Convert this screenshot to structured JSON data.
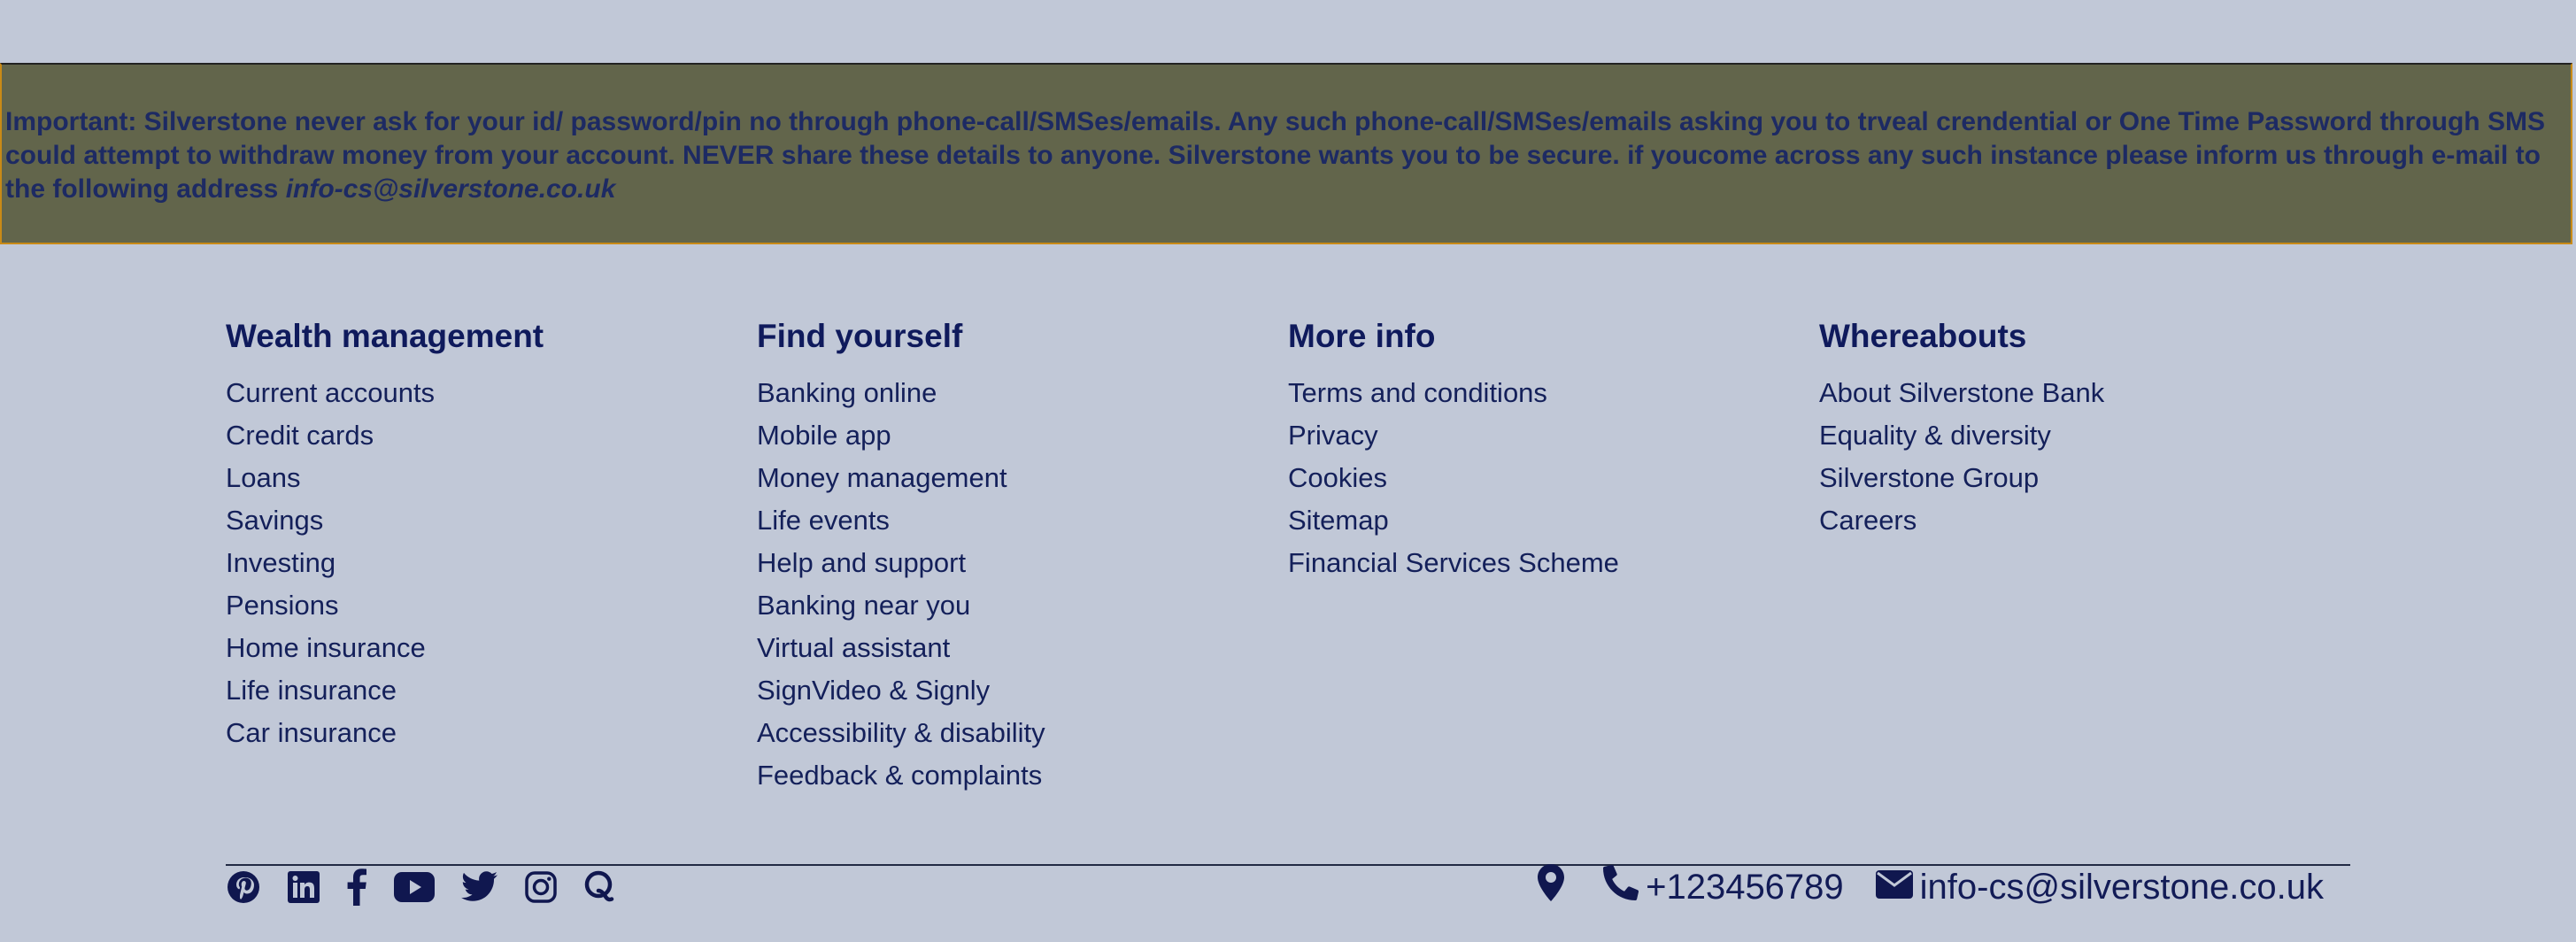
{
  "notice": {
    "text": "Important: Silverstone never ask for your id/ password/pin no through phone-call/SMSes/emails. Any such phone-call/SMSes/emails asking you to trveal crendential or One Time Password through SMS could attempt to withdraw money from your account. NEVER share these details to anyone. Silverstone wants you to be secure. if youcome across any such instance please inform us through e-mail to the following address ",
    "email": "info-cs@silverstone.co.uk",
    "background_color": "#62654b",
    "border_color": "#c98a16"
  },
  "footer": {
    "columns": [
      {
        "heading": "Wealth management",
        "links": [
          "Current accounts",
          "Credit cards",
          "Loans",
          "Savings",
          "Investing",
          "Pensions",
          "Home insurance",
          "Life insurance",
          "Car insurance"
        ]
      },
      {
        "heading": "Find yourself",
        "links": [
          "Banking online",
          "Mobile app",
          "Money management",
          "Life events",
          "Help and support",
          "Banking near you",
          "Virtual assistant",
          "SignVideo & Signly",
          "Accessibility & disability",
          "Feedback & complaints"
        ]
      },
      {
        "heading": "More info",
        "links": [
          "Terms and conditions",
          "Privacy",
          "Cookies",
          "Sitemap",
          "Financial Services Scheme"
        ]
      },
      {
        "heading": "Whereabouts",
        "links": [
          "About Silverstone Bank",
          "Equality & diversity",
          "Silverstone Group",
          "Careers"
        ]
      }
    ]
  },
  "social": {
    "icons": [
      "pinterest-icon",
      "linkedin-icon",
      "facebook-icon",
      "youtube-icon",
      "twitter-icon",
      "instagram-icon",
      "quora-icon"
    ]
  },
  "contact": {
    "location_icon": "map-marker-icon",
    "phone_icon": "phone-icon",
    "phone": "+123456789",
    "email_icon": "envelope-icon",
    "email": "info-cs@silverstone.co.uk"
  },
  "colors": {
    "page_background": "#c1c8d7",
    "text_primary": "#141a55"
  }
}
